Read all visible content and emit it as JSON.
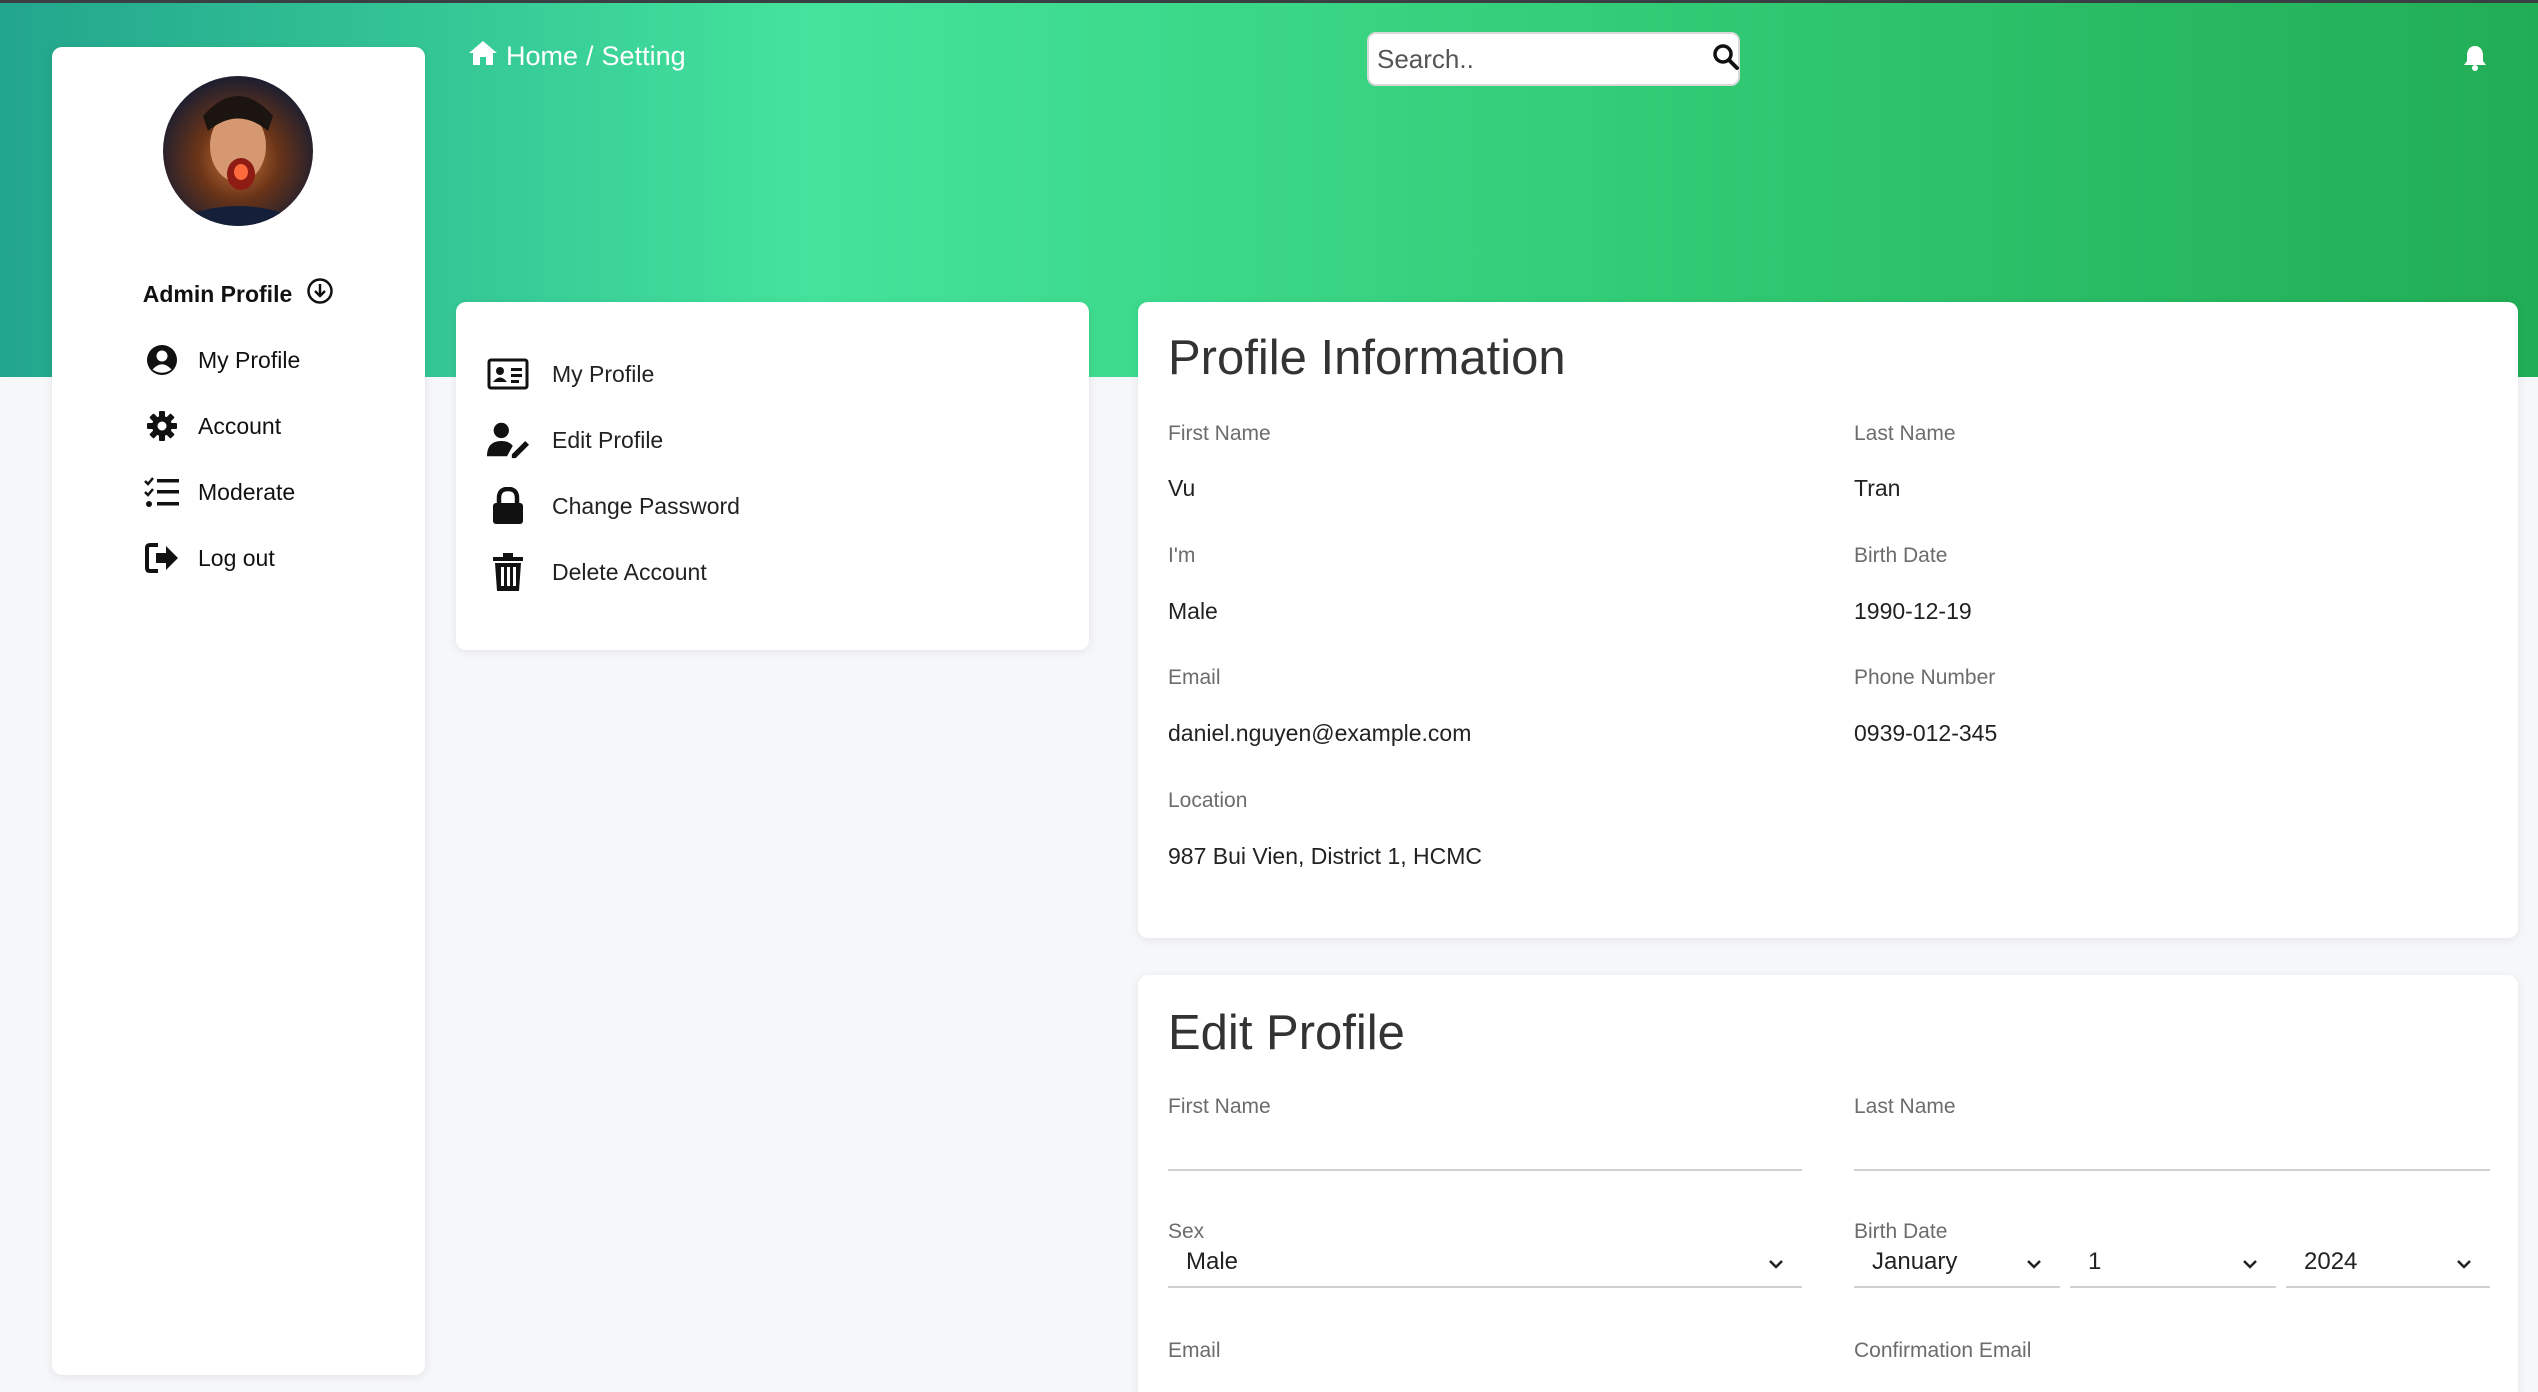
{
  "breadcrumb": {
    "home": "Home",
    "separator": "/",
    "current": "Setting"
  },
  "search": {
    "placeholder": "Search.."
  },
  "sidebar": {
    "profile_name": "Admin Profile",
    "items": [
      {
        "label": "My Profile",
        "icon": "user-circle-icon"
      },
      {
        "label": "Account",
        "icon": "gear-icon"
      },
      {
        "label": "Moderate",
        "icon": "list-check-icon"
      },
      {
        "label": "Log out",
        "icon": "logout-icon"
      }
    ]
  },
  "menu": {
    "items": [
      {
        "label": "My Profile",
        "icon": "id-card-icon"
      },
      {
        "label": "Edit Profile",
        "icon": "user-edit-icon"
      },
      {
        "label": "Change Password",
        "icon": "lock-icon"
      },
      {
        "label": "Delete Account",
        "icon": "trash-icon"
      }
    ]
  },
  "profile_info": {
    "title": "Profile Information",
    "first_name_label": "First Name",
    "first_name": "Vu",
    "last_name_label": "Last Name",
    "last_name": "Tran",
    "gender_label": "I'm",
    "gender": "Male",
    "birth_label": "Birth Date",
    "birth": "1990-12-19",
    "email_label": "Email",
    "email": "daniel.nguyen@example.com",
    "phone_label": "Phone Number",
    "phone": "0939-012-345",
    "location_label": "Location",
    "location": "987 Bui Vien, District 1, HCMC"
  },
  "edit_profile": {
    "title": "Edit Profile",
    "first_name_label": "First Name",
    "first_name_value": "",
    "last_name_label": "Last Name",
    "last_name_value": "",
    "sex_label": "Sex",
    "sex_value": "Male",
    "birth_label": "Birth Date",
    "month_value": "January",
    "day_value": "1",
    "year_value": "2024",
    "email_label": "Email",
    "confirm_email_label": "Confirmation Email"
  },
  "colors": {
    "banner_start": "#22a58d",
    "banner_mid": "#44e39c",
    "banner_end": "#21ad55"
  }
}
